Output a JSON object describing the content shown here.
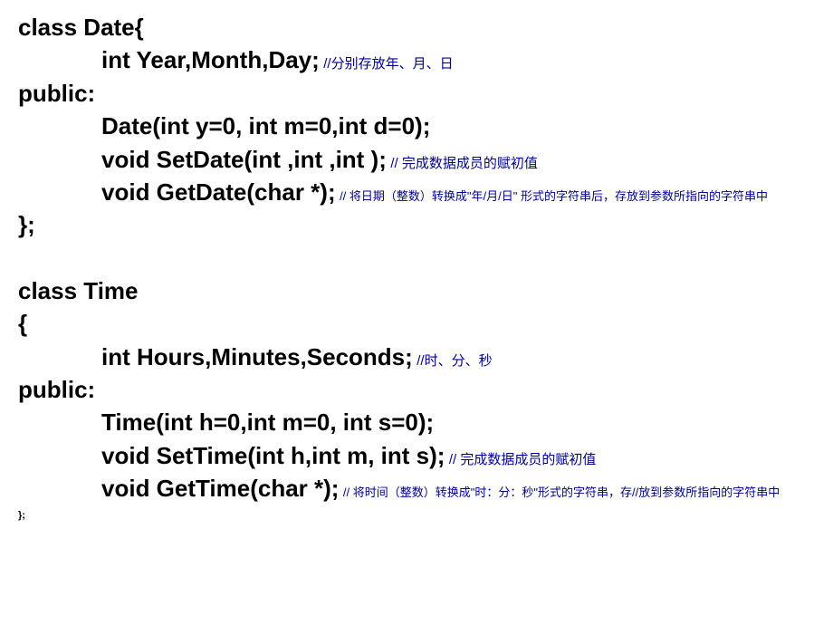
{
  "lines": {
    "l1_code": "class  Date{",
    "l2_code": "int Year,Month,Day;",
    "l2_comment": "  //分别存放年、月、日",
    "l3_code": "public:",
    "l4_code": "Date(int y=0, int m=0,int d=0);",
    "l5_code": "void SetDate(int ,int ,int );",
    "l5_comment": " // 完成数据成员的赋初值",
    "l6_code": "void GetDate(char *);",
    "l6_comment": "  //  将日期（整数）转换成\"年/月/日\"  形式的字符串后，存放到参数所指向的字符串中",
    "l7_code": "};",
    "l8_code": "class Time",
    "l9_code": "{",
    "l10_code": "int Hours,Minutes,Seconds;",
    "l10_comment": "        //时、分、秒",
    "l11_code": "public:",
    "l12_code": "Time(int h=0,int m=0, int s=0);",
    "l13_code": "void SetTime(int h,int m, int s);",
    "l13_comment": " // 完成数据成员的赋初值",
    "l14_code": "void GetTime(char *);",
    "l14_comment": " // 将时间（整数）转换成\"时：分：秒\"形式的字符串，存//放到参数所指向的字符串中",
    "l15_code": "};"
  }
}
